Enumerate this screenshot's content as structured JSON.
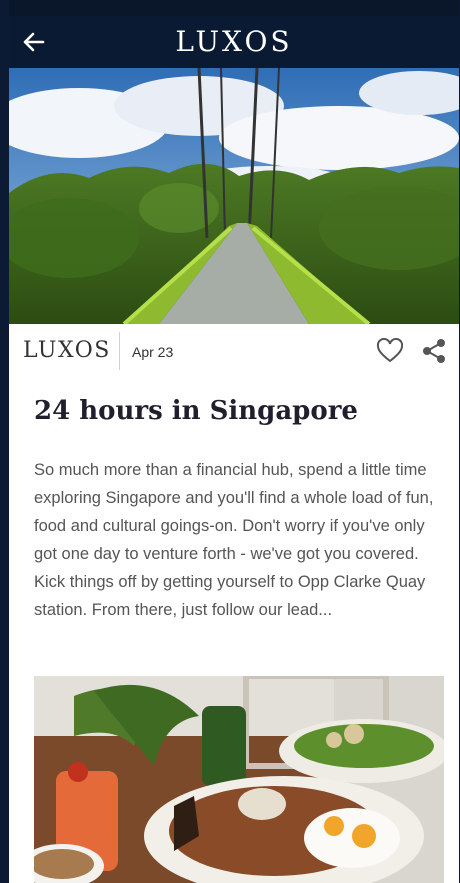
{
  "app": {
    "brand": "LUXOS"
  },
  "nav": {
    "back_icon": "arrow-left-icon"
  },
  "article": {
    "brand": "LUXOS",
    "date": "Apr 23",
    "title": "24 hours in Singapore",
    "body": "So much more than a financial hub, spend a little time exploring Singapore and you'll find a whole load of fun, food and cultural goings-on. Don't worry if you've only got one day to venture forth - we've got you covered. Kick things off by getting yourself to Opp Clarke Quay station. From there, just follow our lead...",
    "like_icon": "heart-outline-icon",
    "share_icon": "share-icon"
  },
  "colors": {
    "appbar": "#0b1a33",
    "background": "#0c1a33",
    "text": "#555555",
    "title": "#1f1f2e"
  }
}
